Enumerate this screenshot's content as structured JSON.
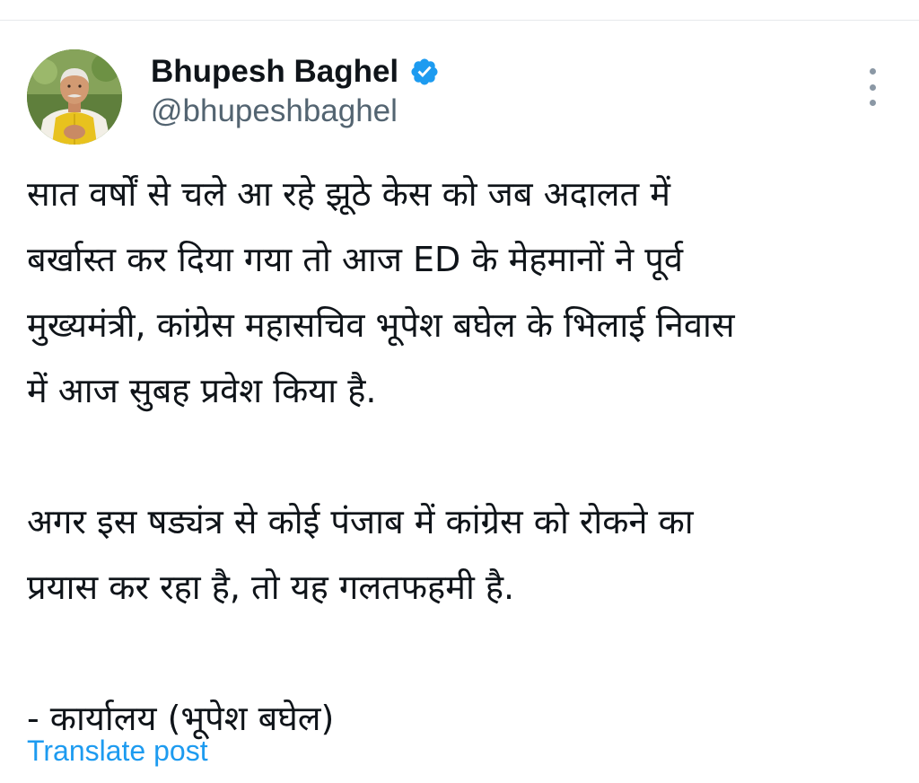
{
  "author": {
    "name": "Bhupesh Baghel",
    "handle": "@bhupeshbaghel",
    "verified": true,
    "avatar_icon": "profile-photo"
  },
  "tweet": {
    "paragraphs": [
      "सात वर्षों से चले आ रहे झूठे केस को जब अदालत में\nबर्खास्त कर दिया गया तो आज ED के मेहमानों ने पूर्व\nमुख्यमंत्री, कांग्रेस महासचिव भूपेश बघेल के भिलाई निवास\nमें आज सुबह प्रवेश किया है.",
      "अगर इस षड्यंत्र से कोई पंजाब में कांग्रेस को रोकने का\nप्रयास कर रहा है, तो यह गलतफहमी है.",
      "- कार्यालय (भूपेश बघेल)"
    ],
    "translate_label": "Translate post"
  },
  "colors": {
    "link_blue": "#1d9bf0",
    "verified_blue": "#1d9bf0",
    "handle_gray": "#536471",
    "text_primary": "#0f1419"
  },
  "icons": {
    "verified": "verified-badge-icon",
    "more": "more-options-icon"
  }
}
